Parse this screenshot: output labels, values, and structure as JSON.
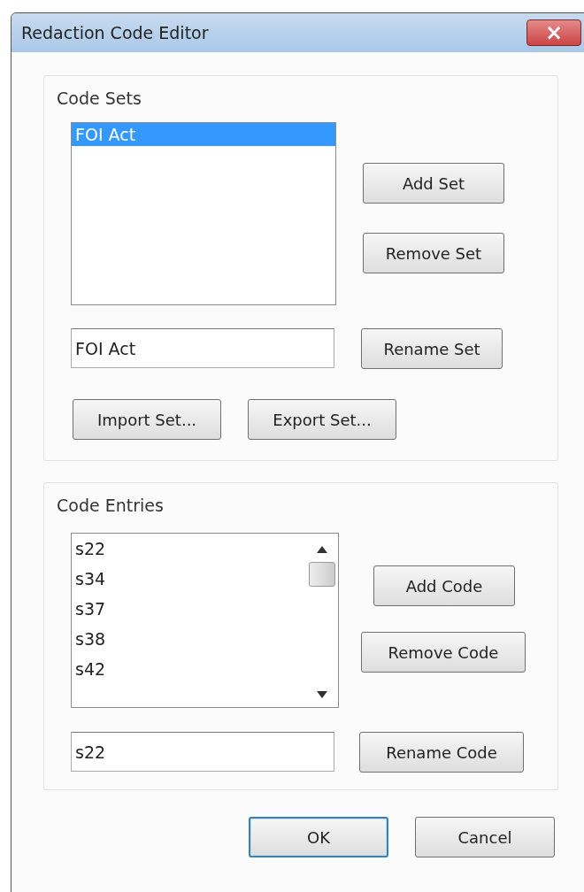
{
  "window": {
    "title": "Redaction Code Editor",
    "close": "×"
  },
  "code_sets": {
    "title": "Code Sets",
    "items": [
      {
        "label": "FOI Act",
        "selected": true
      }
    ],
    "buttons": [
      "Add Set",
      "Remove Set"
    ],
    "name_field": {
      "value": "FOI Act"
    },
    "rename_button": "Rename Set",
    "io_buttons": [
      "Import Set...",
      "Export Set..."
    ]
  },
  "code_entries": {
    "title": "Code Entries",
    "items": [
      {
        "label": "s22",
        "selected": false
      },
      {
        "label": "s34",
        "selected": false
      },
      {
        "label": "s37",
        "selected": false
      },
      {
        "label": "s38",
        "selected": false
      },
      {
        "label": "s42",
        "selected": false
      }
    ],
    "buttons": [
      "Add Code",
      "Remove Code"
    ],
    "name_field": {
      "value": "s22"
    },
    "rename_button": "Rename Code"
  },
  "buttons": [
    {
      "label": "OK",
      "default": true
    },
    {
      "label": "Cancel",
      "default": false
    }
  ]
}
